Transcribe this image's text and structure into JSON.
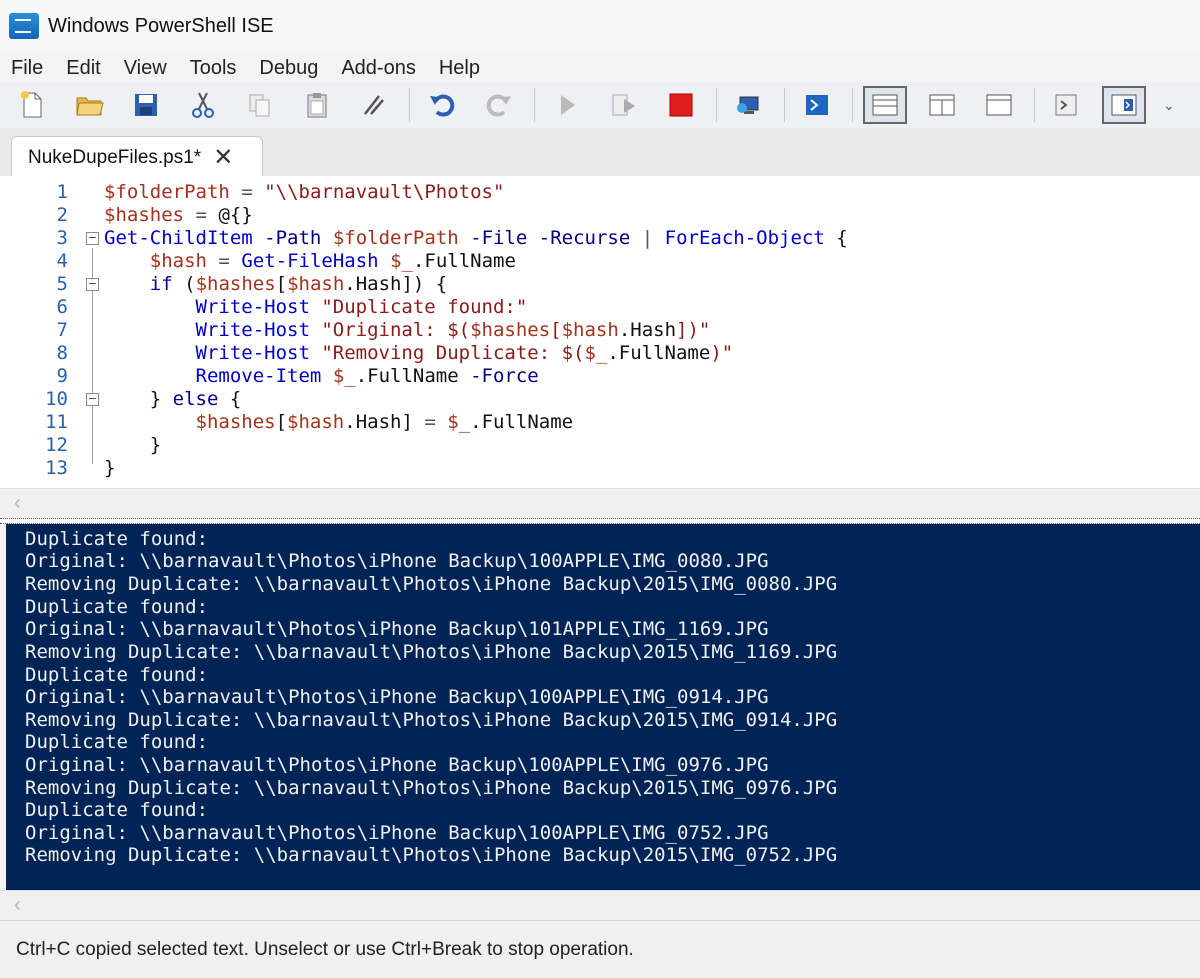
{
  "window": {
    "title": "Windows PowerShell ISE"
  },
  "menu": [
    "File",
    "Edit",
    "View",
    "Tools",
    "Debug",
    "Add-ons",
    "Help"
  ],
  "toolbar": {
    "icons": [
      "new-file-icon",
      "open-folder-icon",
      "save-icon",
      "cut-icon",
      "copy-icon",
      "paste-icon",
      "clear-pane-icon",
      "undo-icon",
      "redo-icon",
      "run-script-icon",
      "run-selection-icon",
      "stop-icon",
      "remote-powershell-icon",
      "powershell-console-icon",
      "script-pane-top-icon",
      "script-pane-right-icon",
      "script-pane-maximized-icon",
      "show-command-window-icon",
      "show-command-addon-icon"
    ],
    "more_glyph": "⌄"
  },
  "tab": {
    "label": "NukeDupeFiles.ps1*",
    "close_glyph": "✕"
  },
  "editor": {
    "lines": [
      {
        "n": "1",
        "text": "$folderPath = \"\\\\barnavault\\Photos\""
      },
      {
        "n": "2",
        "text": "$hashes = @{}"
      },
      {
        "n": "3",
        "text": "Get-ChildItem -Path $folderPath -File -Recurse | ForEach-Object {"
      },
      {
        "n": "4",
        "text": "    $hash = Get-FileHash $_.FullName"
      },
      {
        "n": "5",
        "text": "    if ($hashes[$hash.Hash]) {"
      },
      {
        "n": "6",
        "text": "        Write-Host \"Duplicate found:\""
      },
      {
        "n": "7",
        "text": "        Write-Host \"Original: $($hashes[$hash.Hash])\""
      },
      {
        "n": "8",
        "text": "        Write-Host \"Removing Duplicate: $($_.FullName)\""
      },
      {
        "n": "9",
        "text": "        Remove-Item $_.FullName -Force"
      },
      {
        "n": "10",
        "text": "    } else {"
      },
      {
        "n": "11",
        "text": "        $hashes[$hash.Hash] = $_.FullName"
      },
      {
        "n": "12",
        "text": "    }"
      },
      {
        "n": "13",
        "text": "}"
      }
    ]
  },
  "console": {
    "lines": [
      "Duplicate found:",
      "Original: \\\\barnavault\\Photos\\iPhone Backup\\100APPLE\\IMG_0080.JPG",
      "Removing Duplicate: \\\\barnavault\\Photos\\iPhone Backup\\2015\\IMG_0080.JPG",
      "Duplicate found:",
      "Original: \\\\barnavault\\Photos\\iPhone Backup\\101APPLE\\IMG_1169.JPG",
      "Removing Duplicate: \\\\barnavault\\Photos\\iPhone Backup\\2015\\IMG_1169.JPG",
      "Duplicate found:",
      "Original: \\\\barnavault\\Photos\\iPhone Backup\\100APPLE\\IMG_0914.JPG",
      "Removing Duplicate: \\\\barnavault\\Photos\\iPhone Backup\\2015\\IMG_0914.JPG",
      "Duplicate found:",
      "Original: \\\\barnavault\\Photos\\iPhone Backup\\100APPLE\\IMG_0976.JPG",
      "Removing Duplicate: \\\\barnavault\\Photos\\iPhone Backup\\2015\\IMG_0976.JPG",
      "Duplicate found:",
      "Original: \\\\barnavault\\Photos\\iPhone Backup\\100APPLE\\IMG_0752.JPG",
      "Removing Duplicate: \\\\barnavault\\Photos\\iPhone Backup\\2015\\IMG_0752.JPG"
    ],
    "background": "#012456"
  },
  "scroll": {
    "left_arrow": "‹"
  },
  "status": {
    "text": "Ctrl+C copied selected text. Unselect or use Ctrl+Break to stop operation."
  }
}
